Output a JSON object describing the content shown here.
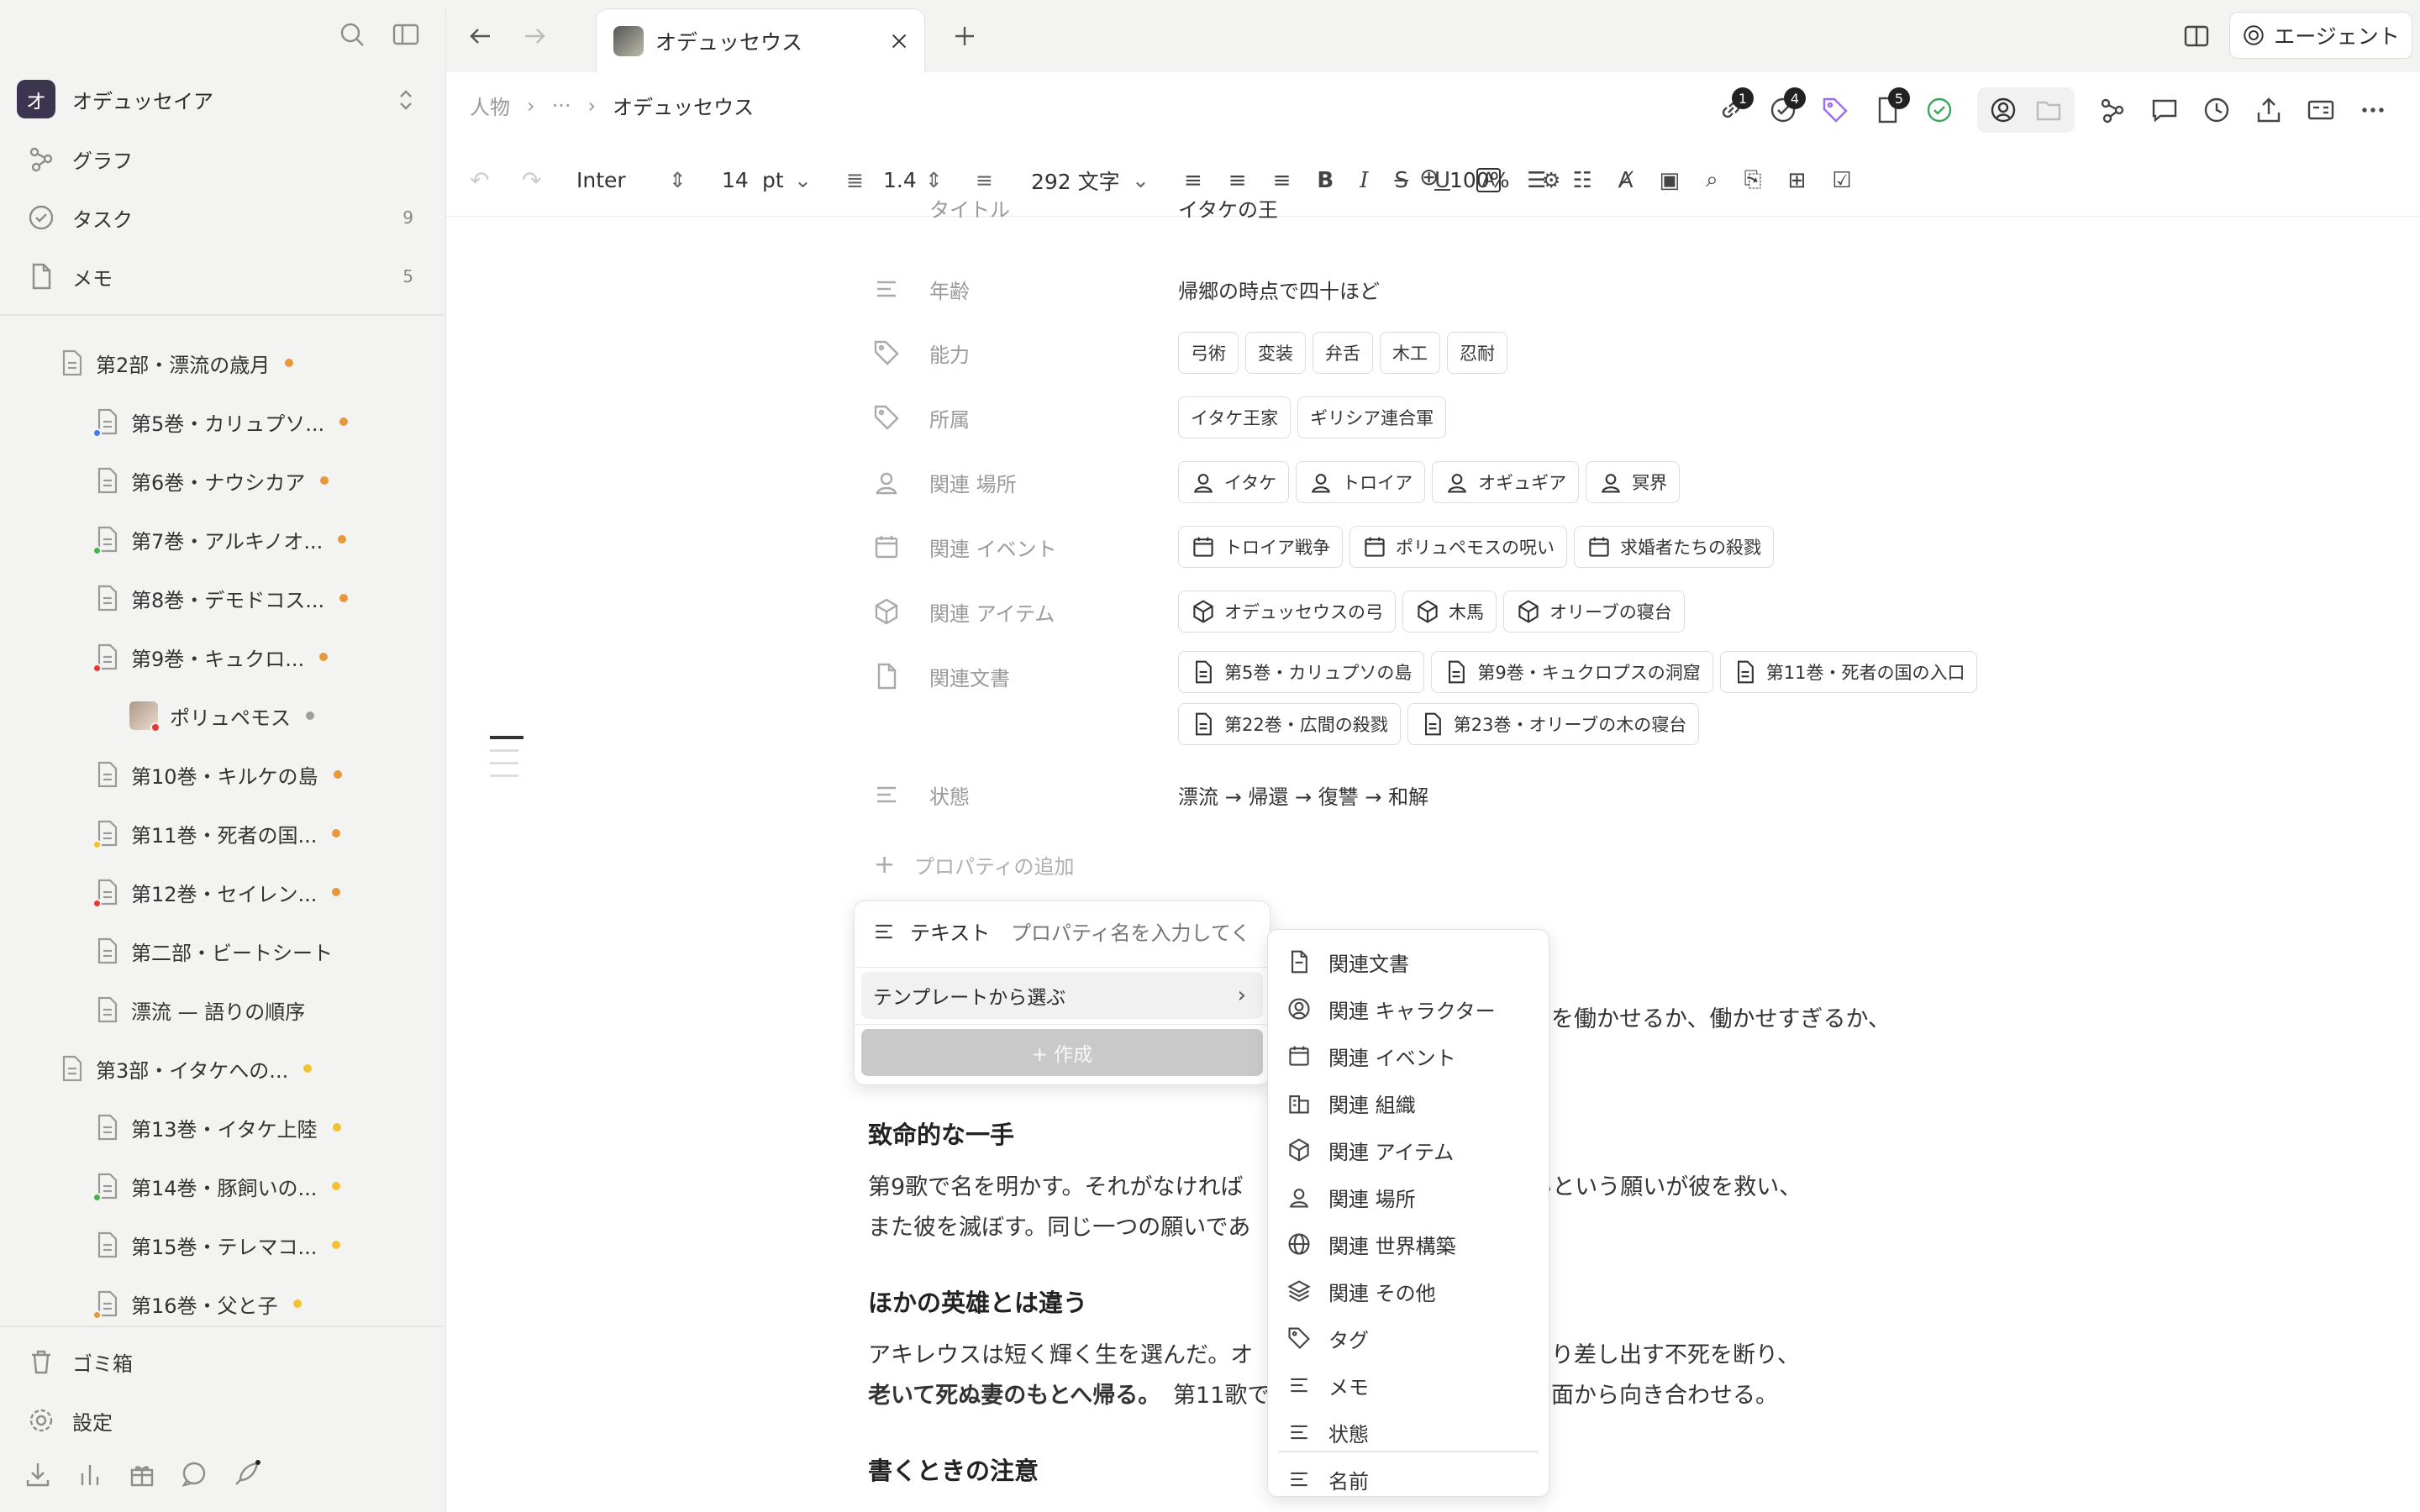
{
  "sidebar": {
    "workspace": {
      "initial": "オ",
      "name": "オデュッセイア"
    },
    "nav": [
      {
        "label": "グラフ",
        "count": ""
      },
      {
        "label": "タスク",
        "count": "9"
      },
      {
        "label": "メモ",
        "count": "5"
      }
    ],
    "tree": [
      {
        "label": "第2部・漂流の歳月",
        "dot": "#e8973a",
        "indent": 0,
        "badge": ""
      },
      {
        "label": "第5巻・カリュプソ...",
        "dot": "#e8973a",
        "indent": 1,
        "badge": "#4a7de0"
      },
      {
        "label": "第6巻・ナウシカア",
        "dot": "#e8973a",
        "indent": 1,
        "badge": ""
      },
      {
        "label": "第7巻・アルキノオ...",
        "dot": "#e8973a",
        "indent": 1,
        "badge": "#4caf50"
      },
      {
        "label": "第8巻・デモドコス...",
        "dot": "#e8973a",
        "indent": 1,
        "badge": ""
      },
      {
        "label": "第9巻・キュクロ...",
        "dot": "#e8973a",
        "indent": 1,
        "badge": "#e53935"
      },
      {
        "label": "ポリュペモス",
        "dot": "#9e9e9e",
        "indent": 2,
        "badge": ""
      },
      {
        "label": "第10巻・キルケの島",
        "dot": "#e8973a",
        "indent": 1,
        "badge": ""
      },
      {
        "label": "第11巻・死者の国...",
        "dot": "#e8973a",
        "indent": 1,
        "badge": "#f2c230"
      },
      {
        "label": "第12巻・セイレン...",
        "dot": "#e8973a",
        "indent": 1,
        "badge": "#e53935"
      },
      {
        "label": "第二部・ビートシート",
        "dot": "",
        "indent": 1,
        "badge": ""
      },
      {
        "label": "漂流 — 語りの順序",
        "dot": "",
        "indent": 1,
        "badge": ""
      },
      {
        "label": "第3部・イタケへの...",
        "dot": "#f2c230",
        "indent": 0,
        "badge": ""
      },
      {
        "label": "第13巻・イタケ上陸",
        "dot": "#f2c230",
        "indent": 1,
        "badge": ""
      },
      {
        "label": "第14巻・豚飼いの...",
        "dot": "#f2c230",
        "indent": 1,
        "badge": "#4caf50"
      },
      {
        "label": "第15巻・テレマコ...",
        "dot": "#f2c230",
        "indent": 1,
        "badge": ""
      },
      {
        "label": "第16巻・父と子",
        "dot": "#f2c230",
        "indent": 1,
        "badge": "#e8973a"
      }
    ],
    "trash": "ゴミ箱",
    "settings": "設定"
  },
  "tab": {
    "title": "オデュッセウス"
  },
  "agent_label": "エージェント",
  "breadcrumb": {
    "root": "人物",
    "ellipsis": "···",
    "current": "オデュッセウス"
  },
  "toolbar_badges": {
    "links": "1",
    "tasks": "4",
    "docs": "5"
  },
  "format": {
    "font": "Inter",
    "size": "14",
    "unit": "pt",
    "line_height": "1.4",
    "word_count": "292 文字",
    "zoom": "100%"
  },
  "properties": {
    "title_label": "タイトル",
    "title_value": "イタケの王",
    "age_label": "年齢",
    "age_value": "帰郷の時点で四十ほど",
    "ability_label": "能力",
    "abilities": [
      "弓術",
      "変装",
      "弁舌",
      "木工",
      "忍耐"
    ],
    "affiliation_label": "所属",
    "affiliations": [
      "イタケ王家",
      "ギリシア連合軍"
    ],
    "places_label": "関連 場所",
    "places": [
      "イタケ",
      "トロイア",
      "オギュギア",
      "冥界"
    ],
    "events_label": "関連 イベント",
    "events": [
      "トロイア戦争",
      "ポリュペモスの呪い",
      "求婚者たちの殺戮"
    ],
    "items_label": "関連 アイテム",
    "items": [
      "オデュッセウスの弓",
      "木馬",
      "オリーブの寝台"
    ],
    "docs_label": "関連文書",
    "docs": [
      "第5巻・カリュプソの島",
      "第9巻・キュクロプスの洞窟",
      "第11巻・死者の国の入口",
      "第22巻・広間の殺戮",
      "第23巻・オリーブの木の寝台"
    ],
    "state_label": "状態",
    "state_value": "漂流 → 帰還 → 復讐 → 和解",
    "add_property": "プロパティの追加"
  },
  "content": {
    "partial_line": "を働かせるか、働かせすぎるか、",
    "h_fatal": "致命的な一手",
    "p1_a": "第9歌で名を明かす。それがなければ",
    "p1_b": "だ。名を残したいという願いが彼を救い、",
    "p1_c": "また彼を滅ぼす。同じ一つの願いであ",
    "h_other": "ほかの英雄とは違う",
    "p2_a": "アキレウスは短く輝く生を選んだ。オ",
    "p2_b": "り差し出す不死を断り、",
    "p2_c_bold": "老いて死ぬ妻のもとへ帰る。",
    "p2_c": "第11歌で",
    "p2_d": "面から向き合わせる。",
    "h_write": "書くときの注意"
  },
  "popup": {
    "type_label": "テキスト",
    "name_placeholder": "プロパティ名を入力してく",
    "template_label": "テンプレートから選ぶ",
    "create_label": "+ 作成"
  },
  "template_menu": [
    {
      "label": "関連文書",
      "icon": "document-icon"
    },
    {
      "label": "関連 キャラクター",
      "icon": "character-icon"
    },
    {
      "label": "関連 イベント",
      "icon": "calendar-icon"
    },
    {
      "label": "関連 組織",
      "icon": "organization-icon"
    },
    {
      "label": "関連 アイテム",
      "icon": "cube-icon"
    },
    {
      "label": "関連 場所",
      "icon": "place-icon"
    },
    {
      "label": "関連 世界構築",
      "icon": "globe-icon"
    },
    {
      "label": "関連 その他",
      "icon": "layers-icon"
    },
    {
      "label": "タグ",
      "icon": "tag-icon"
    },
    {
      "label": "メモ",
      "icon": "text-icon"
    },
    {
      "label": "状態",
      "icon": "text-icon"
    },
    {
      "label": "名前",
      "icon": "text-icon"
    }
  ]
}
